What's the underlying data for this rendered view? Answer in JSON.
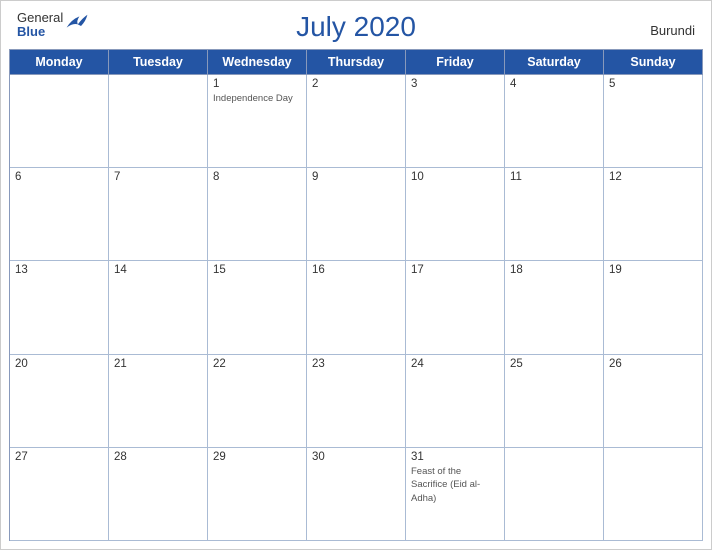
{
  "header": {
    "title": "July 2020",
    "country": "Burundi",
    "logo_general": "General",
    "logo_blue": "Blue"
  },
  "days_of_week": [
    "Monday",
    "Tuesday",
    "Wednesday",
    "Thursday",
    "Friday",
    "Saturday",
    "Sunday"
  ],
  "weeks": [
    [
      {
        "day": "",
        "holiday": ""
      },
      {
        "day": "",
        "holiday": ""
      },
      {
        "day": "1",
        "holiday": "Independence Day"
      },
      {
        "day": "2",
        "holiday": ""
      },
      {
        "day": "3",
        "holiday": ""
      },
      {
        "day": "4",
        "holiday": ""
      },
      {
        "day": "5",
        "holiday": ""
      }
    ],
    [
      {
        "day": "6",
        "holiday": ""
      },
      {
        "day": "7",
        "holiday": ""
      },
      {
        "day": "8",
        "holiday": ""
      },
      {
        "day": "9",
        "holiday": ""
      },
      {
        "day": "10",
        "holiday": ""
      },
      {
        "day": "11",
        "holiday": ""
      },
      {
        "day": "12",
        "holiday": ""
      }
    ],
    [
      {
        "day": "13",
        "holiday": ""
      },
      {
        "day": "14",
        "holiday": ""
      },
      {
        "day": "15",
        "holiday": ""
      },
      {
        "day": "16",
        "holiday": ""
      },
      {
        "day": "17",
        "holiday": ""
      },
      {
        "day": "18",
        "holiday": ""
      },
      {
        "day": "19",
        "holiday": ""
      }
    ],
    [
      {
        "day": "20",
        "holiday": ""
      },
      {
        "day": "21",
        "holiday": ""
      },
      {
        "day": "22",
        "holiday": ""
      },
      {
        "day": "23",
        "holiday": ""
      },
      {
        "day": "24",
        "holiday": ""
      },
      {
        "day": "25",
        "holiday": ""
      },
      {
        "day": "26",
        "holiday": ""
      }
    ],
    [
      {
        "day": "27",
        "holiday": ""
      },
      {
        "day": "28",
        "holiday": ""
      },
      {
        "day": "29",
        "holiday": ""
      },
      {
        "day": "30",
        "holiday": ""
      },
      {
        "day": "31",
        "holiday": "Feast of the Sacrifice (Eid al-Adha)"
      },
      {
        "day": "",
        "holiday": ""
      },
      {
        "day": "",
        "holiday": ""
      }
    ]
  ]
}
